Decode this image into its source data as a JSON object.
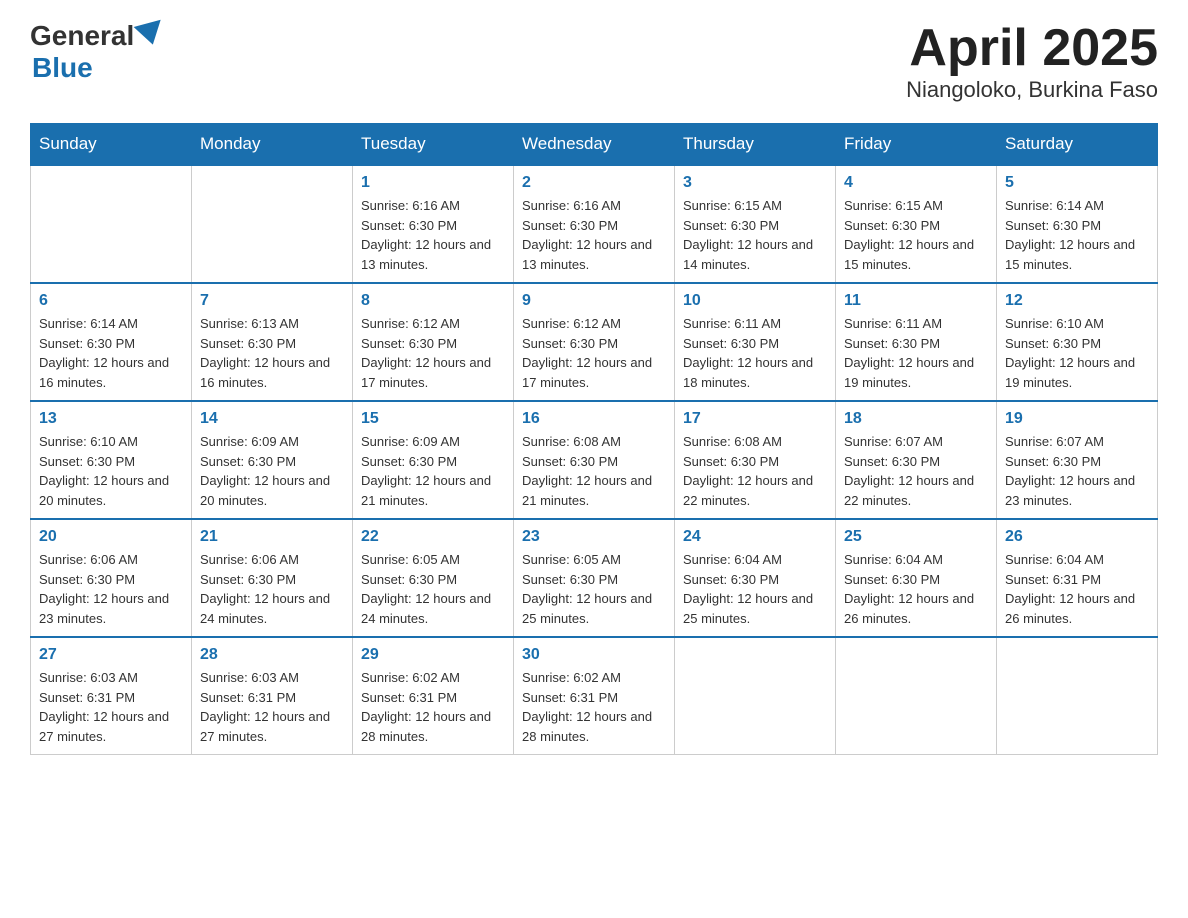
{
  "header": {
    "logo_general": "General",
    "logo_blue": "Blue",
    "month_title": "April 2025",
    "location": "Niangoloko, Burkina Faso"
  },
  "days_of_week": [
    "Sunday",
    "Monday",
    "Tuesday",
    "Wednesday",
    "Thursday",
    "Friday",
    "Saturday"
  ],
  "weeks": [
    [
      {
        "day": "",
        "info": ""
      },
      {
        "day": "",
        "info": ""
      },
      {
        "day": "1",
        "info": "Sunrise: 6:16 AM\nSunset: 6:30 PM\nDaylight: 12 hours\nand 13 minutes."
      },
      {
        "day": "2",
        "info": "Sunrise: 6:16 AM\nSunset: 6:30 PM\nDaylight: 12 hours\nand 13 minutes."
      },
      {
        "day": "3",
        "info": "Sunrise: 6:15 AM\nSunset: 6:30 PM\nDaylight: 12 hours\nand 14 minutes."
      },
      {
        "day": "4",
        "info": "Sunrise: 6:15 AM\nSunset: 6:30 PM\nDaylight: 12 hours\nand 15 minutes."
      },
      {
        "day": "5",
        "info": "Sunrise: 6:14 AM\nSunset: 6:30 PM\nDaylight: 12 hours\nand 15 minutes."
      }
    ],
    [
      {
        "day": "6",
        "info": "Sunrise: 6:14 AM\nSunset: 6:30 PM\nDaylight: 12 hours\nand 16 minutes."
      },
      {
        "day": "7",
        "info": "Sunrise: 6:13 AM\nSunset: 6:30 PM\nDaylight: 12 hours\nand 16 minutes."
      },
      {
        "day": "8",
        "info": "Sunrise: 6:12 AM\nSunset: 6:30 PM\nDaylight: 12 hours\nand 17 minutes."
      },
      {
        "day": "9",
        "info": "Sunrise: 6:12 AM\nSunset: 6:30 PM\nDaylight: 12 hours\nand 17 minutes."
      },
      {
        "day": "10",
        "info": "Sunrise: 6:11 AM\nSunset: 6:30 PM\nDaylight: 12 hours\nand 18 minutes."
      },
      {
        "day": "11",
        "info": "Sunrise: 6:11 AM\nSunset: 6:30 PM\nDaylight: 12 hours\nand 19 minutes."
      },
      {
        "day": "12",
        "info": "Sunrise: 6:10 AM\nSunset: 6:30 PM\nDaylight: 12 hours\nand 19 minutes."
      }
    ],
    [
      {
        "day": "13",
        "info": "Sunrise: 6:10 AM\nSunset: 6:30 PM\nDaylight: 12 hours\nand 20 minutes."
      },
      {
        "day": "14",
        "info": "Sunrise: 6:09 AM\nSunset: 6:30 PM\nDaylight: 12 hours\nand 20 minutes."
      },
      {
        "day": "15",
        "info": "Sunrise: 6:09 AM\nSunset: 6:30 PM\nDaylight: 12 hours\nand 21 minutes."
      },
      {
        "day": "16",
        "info": "Sunrise: 6:08 AM\nSunset: 6:30 PM\nDaylight: 12 hours\nand 21 minutes."
      },
      {
        "day": "17",
        "info": "Sunrise: 6:08 AM\nSunset: 6:30 PM\nDaylight: 12 hours\nand 22 minutes."
      },
      {
        "day": "18",
        "info": "Sunrise: 6:07 AM\nSunset: 6:30 PM\nDaylight: 12 hours\nand 22 minutes."
      },
      {
        "day": "19",
        "info": "Sunrise: 6:07 AM\nSunset: 6:30 PM\nDaylight: 12 hours\nand 23 minutes."
      }
    ],
    [
      {
        "day": "20",
        "info": "Sunrise: 6:06 AM\nSunset: 6:30 PM\nDaylight: 12 hours\nand 23 minutes."
      },
      {
        "day": "21",
        "info": "Sunrise: 6:06 AM\nSunset: 6:30 PM\nDaylight: 12 hours\nand 24 minutes."
      },
      {
        "day": "22",
        "info": "Sunrise: 6:05 AM\nSunset: 6:30 PM\nDaylight: 12 hours\nand 24 minutes."
      },
      {
        "day": "23",
        "info": "Sunrise: 6:05 AM\nSunset: 6:30 PM\nDaylight: 12 hours\nand 25 minutes."
      },
      {
        "day": "24",
        "info": "Sunrise: 6:04 AM\nSunset: 6:30 PM\nDaylight: 12 hours\nand 25 minutes."
      },
      {
        "day": "25",
        "info": "Sunrise: 6:04 AM\nSunset: 6:30 PM\nDaylight: 12 hours\nand 26 minutes."
      },
      {
        "day": "26",
        "info": "Sunrise: 6:04 AM\nSunset: 6:31 PM\nDaylight: 12 hours\nand 26 minutes."
      }
    ],
    [
      {
        "day": "27",
        "info": "Sunrise: 6:03 AM\nSunset: 6:31 PM\nDaylight: 12 hours\nand 27 minutes."
      },
      {
        "day": "28",
        "info": "Sunrise: 6:03 AM\nSunset: 6:31 PM\nDaylight: 12 hours\nand 27 minutes."
      },
      {
        "day": "29",
        "info": "Sunrise: 6:02 AM\nSunset: 6:31 PM\nDaylight: 12 hours\nand 28 minutes."
      },
      {
        "day": "30",
        "info": "Sunrise: 6:02 AM\nSunset: 6:31 PM\nDaylight: 12 hours\nand 28 minutes."
      },
      {
        "day": "",
        "info": ""
      },
      {
        "day": "",
        "info": ""
      },
      {
        "day": "",
        "info": ""
      }
    ]
  ]
}
